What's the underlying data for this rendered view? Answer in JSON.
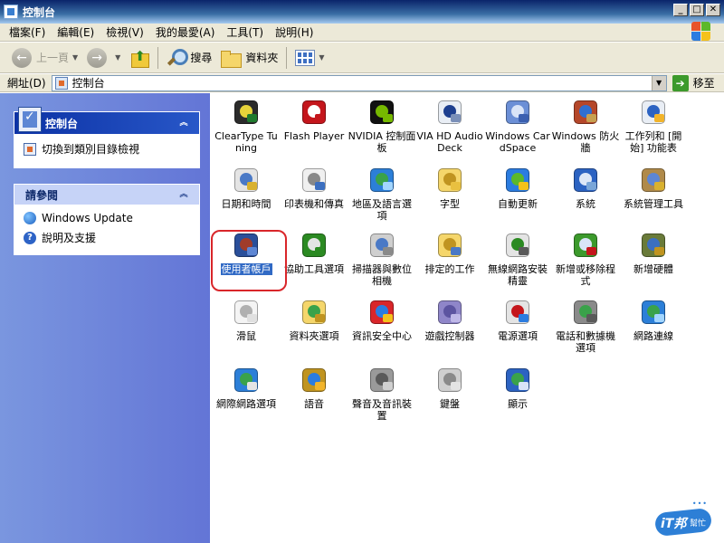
{
  "window": {
    "title": "控制台"
  },
  "menu": [
    "檔案(F)",
    "編輯(E)",
    "檢視(V)",
    "我的最愛(A)",
    "工具(T)",
    "說明(H)"
  ],
  "toolbar": {
    "back": "上一頁",
    "search": "搜尋",
    "folders": "資料夾"
  },
  "address": {
    "label": "網址(D)",
    "value": "控制台",
    "go": "移至"
  },
  "left": {
    "panel_title": "控制台",
    "switch_link": "切換到類別目錄檢視",
    "see_also_title": "請參閱",
    "see_also": [
      "Windows Update",
      "說明及支援"
    ]
  },
  "items": [
    {
      "label": "ClearType Tuning",
      "icon": "cleartype-icon"
    },
    {
      "label": "Flash Player",
      "icon": "flash-player-icon"
    },
    {
      "label": "NVIDIA 控制面板",
      "icon": "nvidia-icon"
    },
    {
      "label": "VIA HD Audio Deck",
      "icon": "via-audio-icon"
    },
    {
      "label": "Windows CardSpace",
      "icon": "cardspace-icon"
    },
    {
      "label": "Windows 防火牆",
      "icon": "firewall-icon"
    },
    {
      "label": "工作列和 [開始] 功能表",
      "icon": "taskbar-icon"
    },
    {
      "label": "日期和時間",
      "icon": "date-time-icon"
    },
    {
      "label": "印表機和傳真",
      "icon": "printer-icon"
    },
    {
      "label": "地區及語言選項",
      "icon": "globe-icon"
    },
    {
      "label": "字型",
      "icon": "fonts-folder-icon"
    },
    {
      "label": "自動更新",
      "icon": "windows-update-icon"
    },
    {
      "label": "系統",
      "icon": "system-icon"
    },
    {
      "label": "系統管理工具",
      "icon": "admin-tools-icon"
    },
    {
      "label": "使用者帳戶",
      "icon": "user-accounts-icon",
      "selected": true
    },
    {
      "label": "協助工具選項",
      "icon": "accessibility-icon"
    },
    {
      "label": "掃描器與數位相機",
      "icon": "scanner-camera-icon"
    },
    {
      "label": "排定的工作",
      "icon": "scheduled-tasks-icon"
    },
    {
      "label": "無線網路安裝精靈",
      "icon": "wireless-network-icon"
    },
    {
      "label": "新增或移除程式",
      "icon": "add-remove-programs-icon"
    },
    {
      "label": "新增硬體",
      "icon": "add-hardware-icon"
    },
    {
      "label": "滑鼠",
      "icon": "mouse-icon"
    },
    {
      "label": "資料夾選項",
      "icon": "folder-options-icon"
    },
    {
      "label": "資訊安全中心",
      "icon": "security-center-icon"
    },
    {
      "label": "遊戲控制器",
      "icon": "game-controller-icon"
    },
    {
      "label": "電源選項",
      "icon": "power-options-icon"
    },
    {
      "label": "電話和數據機選項",
      "icon": "phone-modem-icon"
    },
    {
      "label": "網路連線",
      "icon": "network-connections-icon"
    },
    {
      "label": "網際網路選項",
      "icon": "internet-options-icon"
    },
    {
      "label": "語音",
      "icon": "speech-icon"
    },
    {
      "label": "聲音及音訊裝置",
      "icon": "sound-icon"
    },
    {
      "label": "鍵盤",
      "icon": "keyboard-icon"
    },
    {
      "label": "顯示",
      "icon": "display-icon"
    }
  ],
  "watermark": {
    "logo": "iT邦",
    "sub": "幫忙"
  }
}
